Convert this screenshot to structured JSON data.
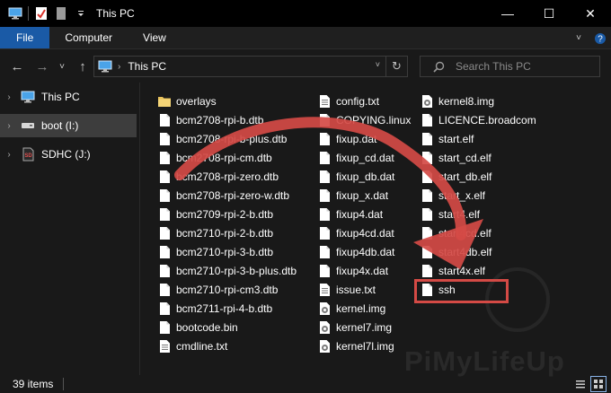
{
  "window": {
    "title": "This PC",
    "minimize_glyph": "—",
    "maximize_glyph": "☐",
    "close_glyph": "✕"
  },
  "ribbon": {
    "tabs": [
      {
        "label": "File"
      },
      {
        "label": "Computer"
      },
      {
        "label": "View"
      }
    ],
    "collapse_glyph": "˅",
    "help_glyph": "?"
  },
  "address": {
    "path": "This PC",
    "back_glyph": "←",
    "forward_glyph": "→",
    "recent_glyph": "˅",
    "up_glyph": "↑",
    "dropdown_glyph": "˅",
    "refresh_glyph": "↻"
  },
  "search": {
    "placeholder": "Search This PC"
  },
  "navpane": {
    "items": [
      {
        "label": "This PC",
        "icon": "computer-icon",
        "selected": false
      },
      {
        "label": "boot (I:)",
        "icon": "drive-icon",
        "selected": true
      },
      {
        "label": "SDHC (J:)",
        "icon": "sd-card-icon",
        "selected": false
      }
    ],
    "expand_glyph": "›",
    "sd_icon_text": "SD"
  },
  "files": {
    "columns": [
      [
        {
          "name": "overlays",
          "type": "folder"
        },
        {
          "name": "bcm2708-rpi-b.dtb",
          "type": "file"
        },
        {
          "name": "bcm2708-rpi-b-plus.dtb",
          "type": "file"
        },
        {
          "name": "bcm2708-rpi-cm.dtb",
          "type": "file"
        },
        {
          "name": "bcm2708-rpi-zero.dtb",
          "type": "file"
        },
        {
          "name": "bcm2708-rpi-zero-w.dtb",
          "type": "file"
        },
        {
          "name": "bcm2709-rpi-2-b.dtb",
          "type": "file"
        },
        {
          "name": "bcm2710-rpi-2-b.dtb",
          "type": "file"
        },
        {
          "name": "bcm2710-rpi-3-b.dtb",
          "type": "file"
        },
        {
          "name": "bcm2710-rpi-3-b-plus.dtb",
          "type": "file"
        },
        {
          "name": "bcm2710-rpi-cm3.dtb",
          "type": "file"
        },
        {
          "name": "bcm2711-rpi-4-b.dtb",
          "type": "file"
        },
        {
          "name": "bootcode.bin",
          "type": "file"
        },
        {
          "name": "cmdline.txt",
          "type": "text"
        }
      ],
      [
        {
          "name": "config.txt",
          "type": "text"
        },
        {
          "name": "COPYING.linux",
          "type": "file"
        },
        {
          "name": "fixup.dat",
          "type": "file"
        },
        {
          "name": "fixup_cd.dat",
          "type": "file"
        },
        {
          "name": "fixup_db.dat",
          "type": "file"
        },
        {
          "name": "fixup_x.dat",
          "type": "file"
        },
        {
          "name": "fixup4.dat",
          "type": "file"
        },
        {
          "name": "fixup4cd.dat",
          "type": "file"
        },
        {
          "name": "fixup4db.dat",
          "type": "file"
        },
        {
          "name": "fixup4x.dat",
          "type": "file"
        },
        {
          "name": "issue.txt",
          "type": "text"
        },
        {
          "name": "kernel.img",
          "type": "image"
        },
        {
          "name": "kernel7.img",
          "type": "image"
        },
        {
          "name": "kernel7l.img",
          "type": "image"
        }
      ],
      [
        {
          "name": "kernel8.img",
          "type": "image"
        },
        {
          "name": "LICENCE.broadcom",
          "type": "file"
        },
        {
          "name": "start.elf",
          "type": "file"
        },
        {
          "name": "start_cd.elf",
          "type": "file"
        },
        {
          "name": "start_db.elf",
          "type": "file"
        },
        {
          "name": "start_x.elf",
          "type": "file"
        },
        {
          "name": "start4.elf",
          "type": "file"
        },
        {
          "name": "start4cd.elf",
          "type": "file"
        },
        {
          "name": "start4db.elf",
          "type": "file"
        },
        {
          "name": "start4x.elf",
          "type": "file"
        },
        {
          "name": "ssh",
          "type": "file"
        }
      ]
    ]
  },
  "status": {
    "item_count": "39 items"
  },
  "annotation": {
    "arrow_color": "#d44a45",
    "highlight_target": "ssh"
  },
  "watermark": {
    "text": "PiMyLifeUp"
  },
  "colors": {
    "accent": "#1a5aa6",
    "background": "#191919",
    "selection": "#3d3d3d"
  }
}
